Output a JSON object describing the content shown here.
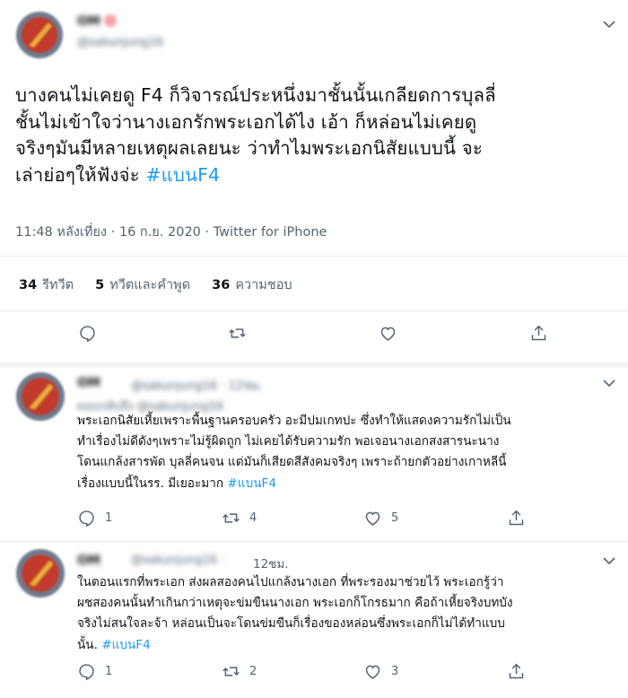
{
  "main_tweet": {
    "name": "OM",
    "handle": "@sakunjung16",
    "lines": [
      "บางคนไม่เคยดู F4 ก็วิจารณ์ประหนึ่งมาชั้นนั้นเกลียดการบุลลี่",
      "ชั้นไม่เข้าใจว่านางเอกรักพระเอกได้ไง เอ้า  ก็หล่อนไม่เคยดู",
      "จริงๆมันมีหลายเหตุผลเลยนะ ว่าทำไมพระเอกนิสัยแบบนี้ จะ",
      "เล่าย่อๆให้ฟังจ่ะ "
    ],
    "hashtag": "#แบนF4",
    "timestamp": "11:48 หลังเที่ยง · 16 ก.ย. 2020 · Twitter for iPhone",
    "retweets_count": "34",
    "retweets_label": "รีทวีต",
    "quotes_count": "5",
    "quotes_label": "ทวีตและคำพูด",
    "likes_count": "36",
    "likes_label": "ความชอบ"
  },
  "replies": [
    {
      "name": "OM",
      "handle": "@sakunjung16 · 12ชม.",
      "replying_to": "ตอบกลับถึง @sakunjung16",
      "lines": [
        "พระเอกนิสัยเหี้ยเพราะพื้นฐานครอบครัว อะมีปมเกทปะ ซึ่งทำให้แสดงความรักไม่เป็น",
        "ทำเรื่องไม่ดีดังๆเพราะไม่รู้ผิดถูก ไม่เคยได้รับความรัก พอเจอนางเอกสงสารนะนาง",
        "โดนแกล้งสารพัด บุลลี่คนจน แต่มันก็เสียดสีสังคมจริงๆ เพราะถ้ายกตัวอย่างเกาหลีนี้",
        "เรื่องแบบนี้ในรร. มีเยอะมาก "
      ],
      "hashtag": "#แบนF4",
      "reply_count": "1",
      "retweet_count": "4",
      "like_count": "5"
    },
    {
      "name": "OM",
      "handle": "@sakunjung16 · ",
      "time": "12ชม.",
      "lines": [
        "ในตอนแรกที่พระเอก ส่งผลสองคนไปแกล้งนางเอก ที่พระรองมาช่วยไว้ พระเอกรู้ว่า",
        "ผชสองคนนั้นทำเกินกว่าเหตุจะข่มขืนนางเอก พระเอกก็โกรธมาก คือถ้าเหี้ยจริงบทบัง",
        "จริงไม่สนใจละจ้า  หล่อนเป็นจะโดนข่มขืนก็เรื่องของหล่อนซึ่งพระเอกก็ไม่ได้ทำแบบ",
        "นั้น. "
      ],
      "hashtag": "#แบนF4",
      "reply_count": "1",
      "retweet_count": "2",
      "like_count": "3"
    }
  ]
}
